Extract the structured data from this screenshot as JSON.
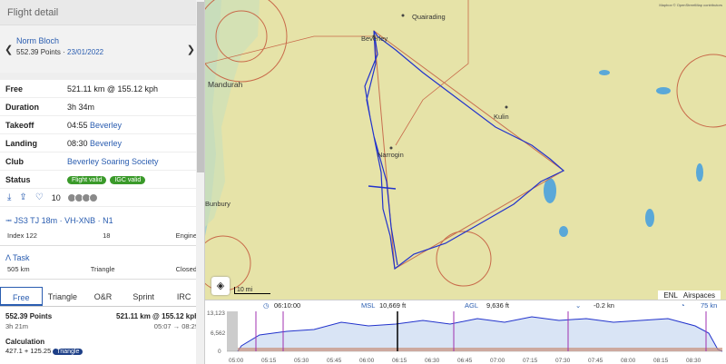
{
  "header": {
    "title": "Flight detail"
  },
  "pilot": {
    "name": "Norm Bloch",
    "points": "552.39 Points",
    "separator": " · ",
    "date": "23/01/2022"
  },
  "details": [
    {
      "key": "Free",
      "value": "521.11 km @ 155.12 kph",
      "link": ""
    },
    {
      "key": "Duration",
      "value": "3h 34m",
      "link": ""
    },
    {
      "key": "Takeoff",
      "value": "04:55 ",
      "link": "Beverley"
    },
    {
      "key": "Landing",
      "value": "08:30 ",
      "link": "Beverley"
    },
    {
      "key": "Club",
      "value": "",
      "link": "Beverley Soaring Society"
    }
  ],
  "status": {
    "key": "Status",
    "badges": [
      "Flight valid",
      "IGC valid"
    ],
    "color": "#3a9a2a"
  },
  "actions": {
    "likes": "10"
  },
  "aircraft": {
    "label": "JS3 TJ 18m · VH-XNB · N1",
    "index": "Index 122",
    "seats": "18",
    "engine": "Engine"
  },
  "task": {
    "label": "Task",
    "distance": "505 km",
    "type": "Triangle",
    "status": "Closed"
  },
  "tabs": [
    "Free",
    "Triangle",
    "O&R",
    "Sprint",
    "IRC"
  ],
  "score": {
    "points": "552.39 Points",
    "distance": "521.11 km @ 155.12 kph",
    "duration": "3h 21m",
    "time": "05:07 → 08:29"
  },
  "calculation": {
    "label": "Calculation",
    "value": "427.1 + 125.25 ",
    "badge": "Triangle"
  },
  "map": {
    "places": {
      "quairading": "Quairading",
      "beverley": "Beverley",
      "mandurah": "Mandurah",
      "narrogin": "Narrogin",
      "kulin": "Kulin",
      "bunbury": "Bunbury"
    },
    "scale": "10 mi",
    "toggles": [
      "ENL",
      "Airspaces"
    ],
    "attribution": "Mapbox © OpenStreetMap contributors"
  },
  "barogram": {
    "time": "06:10:00",
    "msl_label": "MSL",
    "msl": "10,669 ft",
    "agl_label": "AGL",
    "agl": "9,636 ft",
    "vario": "-0.2 kn",
    "speed": "75 kn",
    "y_labels": [
      "13,123",
      "6,562",
      "0"
    ],
    "x_labels": [
      "05:00",
      "05:15",
      "05:30",
      "05:45",
      "06:00",
      "06:15",
      "06:30",
      "06:45",
      "07:00",
      "07:15",
      "07:30",
      "07:45",
      "08:00",
      "08:15",
      "08:30"
    ]
  },
  "colors": {
    "accent": "#2a5db0",
    "track": "#2233cc",
    "map": "#e6e3a8",
    "sea": "#a8d0cc",
    "badge": "#3a9a2a"
  }
}
